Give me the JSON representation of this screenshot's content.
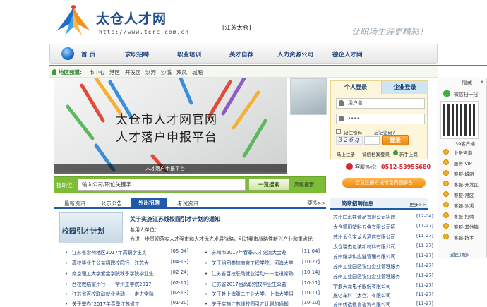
{
  "header": {
    "site_name": "太仓人才网",
    "url": "http://www.tcrc.com.cn",
    "region": "[江苏太仓]",
    "slogan": "让职场生涯更精彩！"
  },
  "nav": [
    "首 页",
    "求职招聘",
    "职业培训",
    "英才自荐",
    "人力资源公司",
    "德企人才网"
  ],
  "subnav": {
    "label": "地区频道:",
    "items": [
      "市中心",
      "港区",
      "开发区",
      "浏河",
      "沙溪",
      "双凤",
      "城厢"
    ]
  },
  "banner": {
    "line1": "太仓市人才网官网",
    "line2": "人才落户申报平台",
    "caption": "人才落户申报平台"
  },
  "search": {
    "label": "搜职位:",
    "placeholder": "输入公司/职位关键字",
    "button": "一览搜索",
    "advanced": "高级搜索"
  },
  "tabs": [
    "最新资讯",
    "公示公告",
    "外出招聘",
    "考试资讯"
  ],
  "more": "更多>>",
  "featured": {
    "image_text": "校园引才计划",
    "title": "关于实施江苏线校园引才计划的通知",
    "body1": "各用人单位：",
    "body2": "为进一步贯彻落实人才强市和人才优先发展战略，引进我市战略性新兴产业和重点优"
  },
  "news_left": [
    {
      "title": "江苏省常州地区2017年高职学生实",
      "date": "[05-04]"
    },
    {
      "title": "高校毕业生公益招聘校园行一江苏大",
      "date": "[04-13]"
    },
    {
      "title": "南京理工大学紫金学院秋季学院毕业生",
      "date": "[02-24]"
    },
    {
      "title": "西校教结富州行——常州工学院2017",
      "date": "[02-17]"
    },
    {
      "title": "江苏省百校联动就业活动——走进常熟",
      "date": "[02-13]"
    },
    {
      "title": "关于举办“2017年春季江苏省工",
      "date": "[01-20]"
    }
  ],
  "news_right": [
    {
      "title": "苏州市2017年春季人才交流大会邀",
      "date": "[11-04]"
    },
    {
      "title": "关于组团参加南京工程学院、河海大学",
      "date": "[10-27]"
    },
    {
      "title": "江苏省百校联动就业活动——走进常熟",
      "date": "[10-14]"
    },
    {
      "title": "江苏省2017届高职院校毕业生公益",
      "date": "[10-11]"
    },
    {
      "title": "关于赴上海第二工业大学、上海大学招",
      "date": "[10-11]"
    },
    {
      "title": "关于实施江苏线校园引才计划的通知",
      "date": "[10-10]"
    }
  ],
  "login": {
    "tab_personal": "个人登录",
    "tab_company": "企业登录",
    "username_placeholder": "用户名",
    "password_value": "••••",
    "remember": "记住密码",
    "forgot": "忘记密码?",
    "captcha": "326g",
    "login_button": "登录",
    "register": "马上注册",
    "archive": "诚信档案登录",
    "newbie": "新手上路"
  },
  "hotline": {
    "label": "客服热线：",
    "number": "0512-53955680"
  },
  "promo": "会员注册方法常见问题解答",
  "recruit": {
    "title": "简章招聘信息",
    "more": "更多>>",
    "items": [
      {
        "name": "苏州口水娃食品有限公司招聘",
        "date": "[12-04]"
      },
      {
        "name": "太仓德阳塑料五金有限公司招",
        "date": "[11-27]"
      },
      {
        "name": "苏州太仓宝龙大酒店有限公司",
        "date": "[11-27]"
      },
      {
        "name": "太仓瑞杰包装新材料有限公司",
        "date": "[11-27]"
      },
      {
        "name": "苏州耀华供应链管理有限公司",
        "date": "[11-27]"
      },
      {
        "name": "苏州工业园区锐红企业管理服务",
        "date": "[11-27]"
      },
      {
        "name": "苏州工业园区锐红企业管理服务",
        "date": "[11-27]"
      },
      {
        "name": "宇浪天龙电子股份有限公司",
        "date": "[11-27]"
      },
      {
        "name": "施亿车料（太仓）有限公司",
        "date": "[11-27]"
      },
      {
        "name": "苏州优选教育咨询有限公司",
        "date": "[11-27]"
      }
    ]
  },
  "float": {
    "hide": "隐藏",
    "close": "×",
    "wechat": "微信扫一扫",
    "qr_label": "39客户端",
    "items": [
      "业务咨询",
      "服务-VIP",
      "客服-城厢",
      "客服-开发区",
      "客服-港区",
      "客服-沙溪",
      "客服-招聘",
      "客服-其他镇",
      "客服-技术"
    ],
    "back_top": "返回顶部"
  },
  "colors": {
    "brand_blue": "#1e5aa8",
    "green": "#7cbc37",
    "orange": "#f08a12"
  }
}
